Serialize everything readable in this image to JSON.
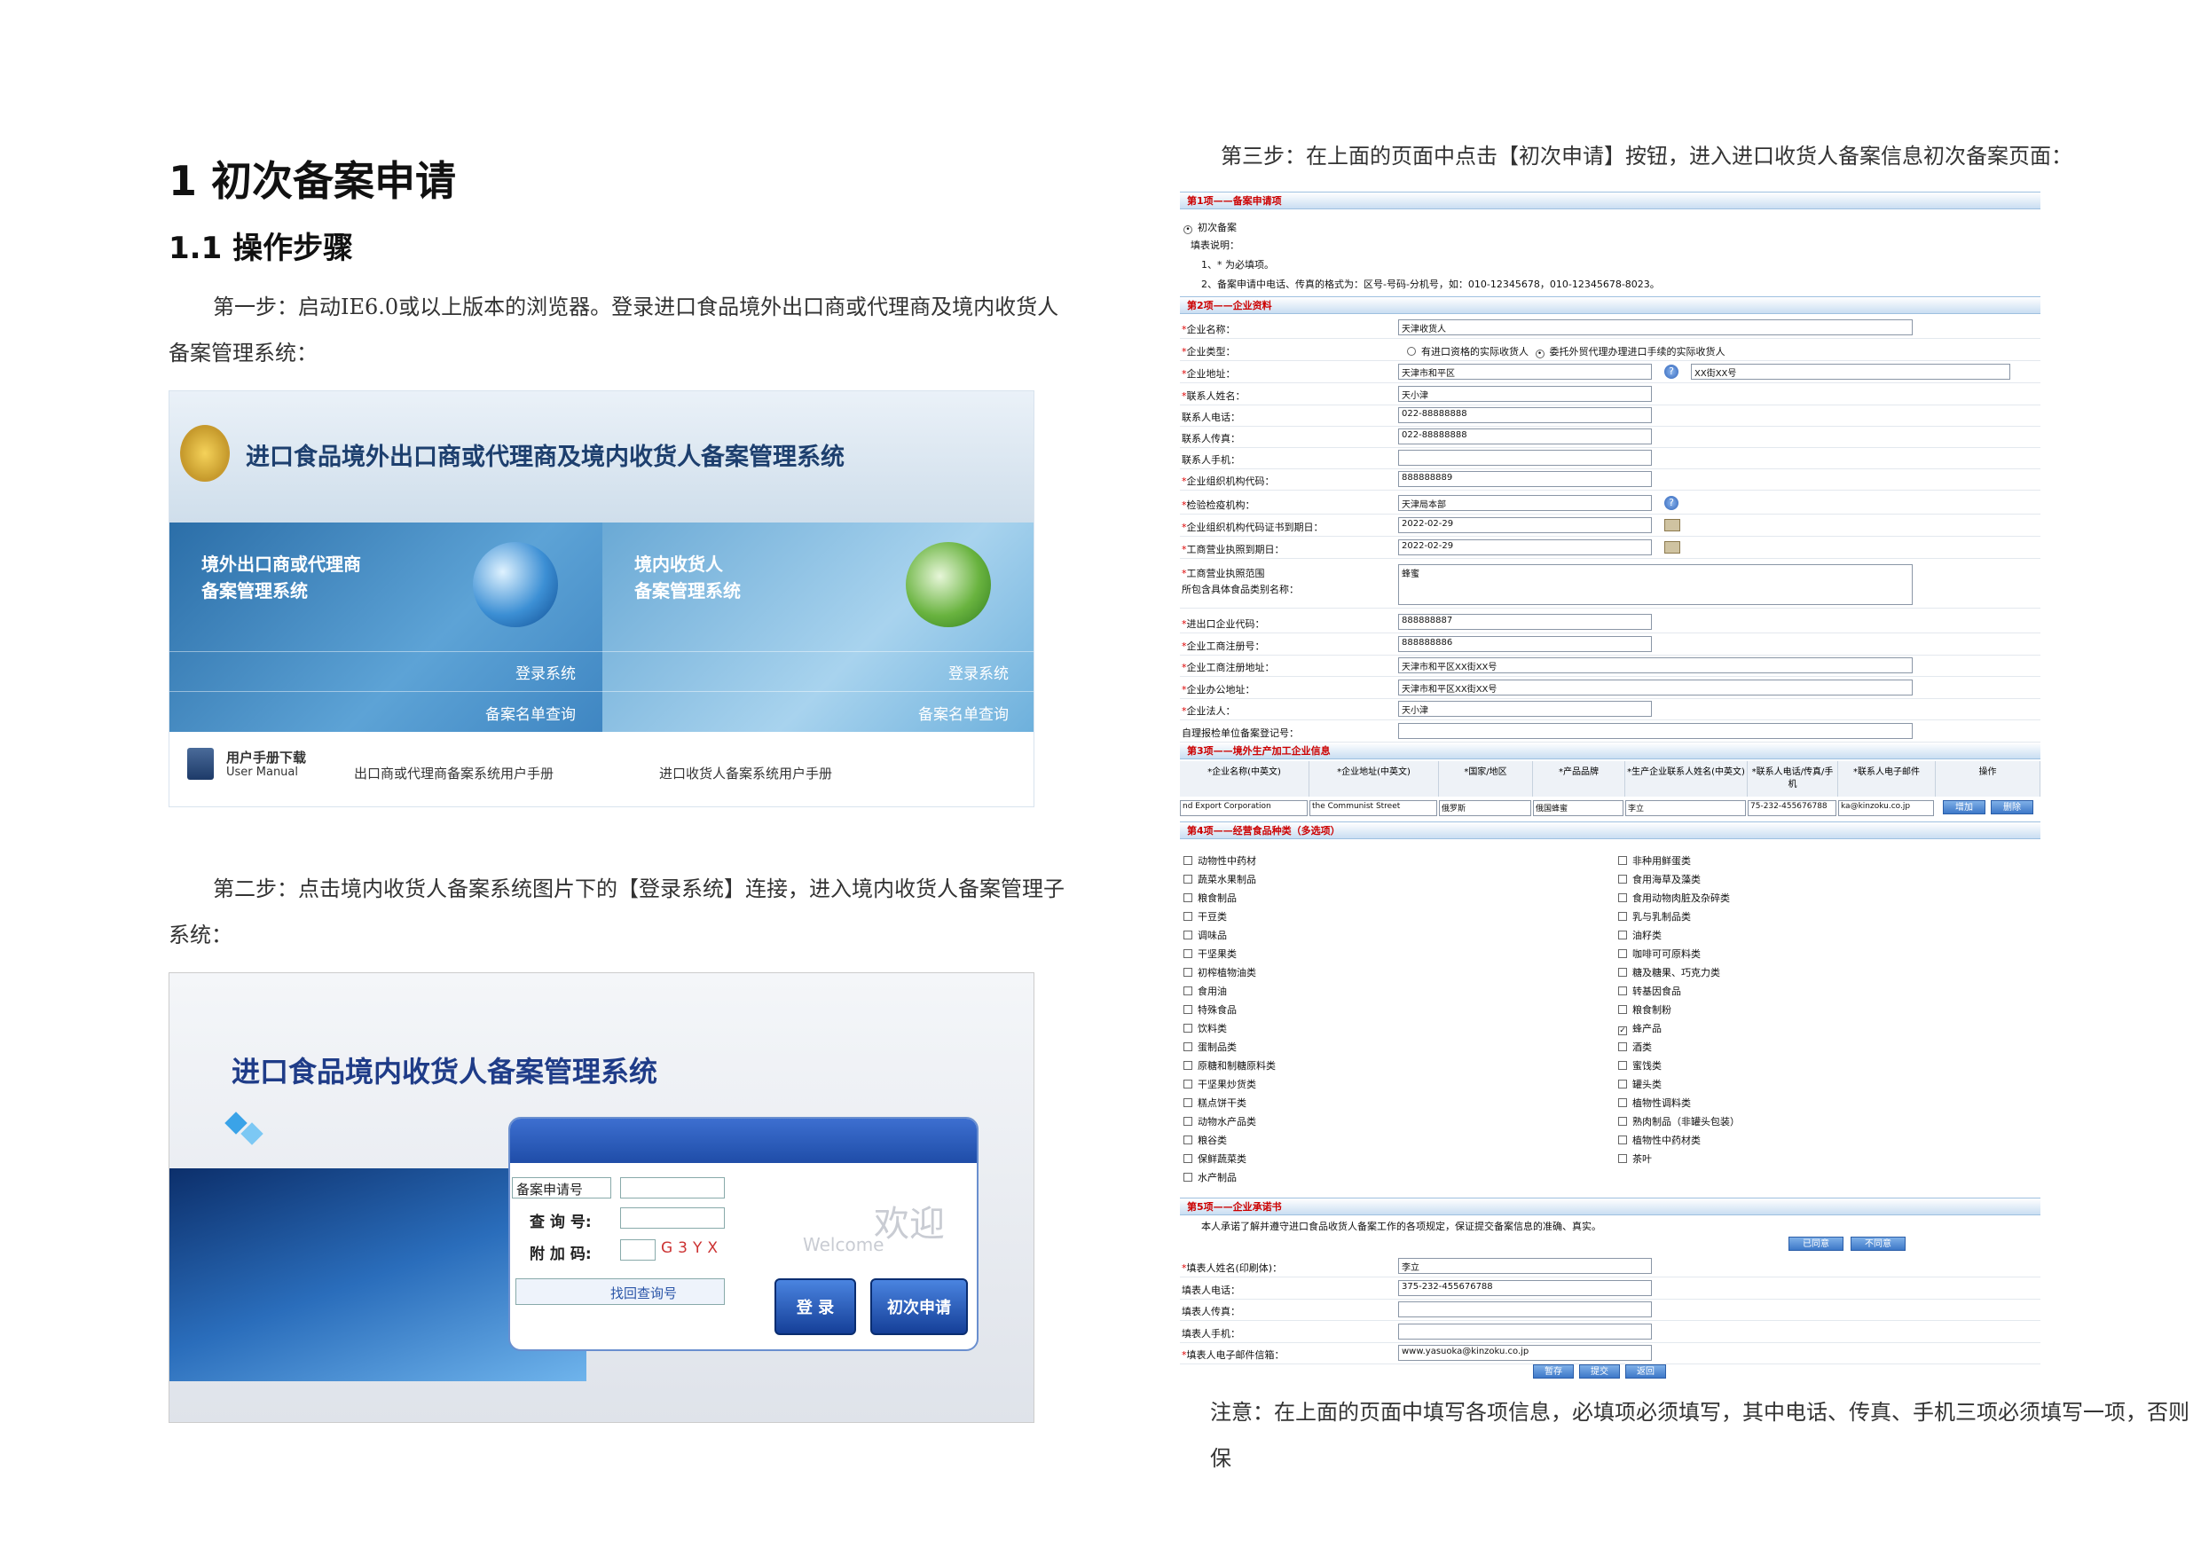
{
  "doc": {
    "h1": "1 初次备案申请",
    "h2": "1.1 操作步骤",
    "step1_line1": "第一步：启动IE6.0或以上版本的浏览器。登录进口食品境外出口商或代理商及境内收货人",
    "step1_line2": "备案管理系统：",
    "step2_line1": "第二步：点击境内收货人备案系统图片下的【登录系统】连接，进入境内收货人备案管理子",
    "step2_line2": "系统：",
    "step3": "第三步：在上面的页面中点击【初次申请】按钮，进入进口收货人备案信息初次备案页面：",
    "note": "注意：在上面的页面中填写各项信息，必填项必须填写，其中电话、传真、手机三项必须填写一项，否则保"
  },
  "shot1": {
    "system_title": "进口食品境外出口商或代理商及境内收货人备案管理系统",
    "left_panel_title": "境外出口商或代理商\n备案管理系统",
    "right_panel_title": "境内收货人\n备案管理系统",
    "login_link": "登录系统",
    "query_link": "备案名单查询",
    "manual_cn": "用户手册下载",
    "manual_en": "User Manual",
    "manual_link1": "出口商或代理商备案系统用户手册",
    "manual_link2": "进口收货人备案系统用户手册"
  },
  "shot2": {
    "title": "进口食品境内收货人备案管理系统",
    "select_value": "备案申请号",
    "query_label": "查 询 号:",
    "captcha_label": "附 加 码:",
    "captcha": "G3YX",
    "find_link": "找回查询号",
    "welcome_cn": "欢迎",
    "welcome_en": "Welcome",
    "login_btn": "登 录",
    "apply_btn": "初次申请"
  },
  "form": {
    "sec1": "第1项——备案申请项",
    "first_filing": "初次备案",
    "notes_title": "填表说明：",
    "note1": "1、* 为必填项。",
    "note2": "2、备案申请中电话、传真的格式为：区号-号码-分机号，如：010-12345678，010-12345678-8023。",
    "sec2": "第2项——企业资料",
    "fields": [
      {
        "label": "企业名称：",
        "req": true,
        "value": "天津收货人",
        "w": "long"
      },
      {
        "label": "企业类型：",
        "req": true,
        "value": "",
        "w": "radio"
      },
      {
        "label": "企业地址：",
        "req": true,
        "value": "天津市和平区",
        "w": "addr"
      },
      {
        "label": "联系人姓名：",
        "req": true,
        "value": "天小津",
        "w": "short"
      },
      {
        "label": "联系人电话：",
        "req": false,
        "value": "022-88888888",
        "w": "short"
      },
      {
        "label": "联系人传真：",
        "req": false,
        "value": "022-88888888",
        "w": "short"
      },
      {
        "label": "联系人手机：",
        "req": false,
        "value": "",
        "w": "short"
      },
      {
        "label": "企业组织机构代码：",
        "req": true,
        "value": "888888889",
        "w": "short"
      },
      {
        "label": "检验检疫机构：",
        "req": true,
        "value": "天津局本部",
        "w": "shortq"
      },
      {
        "label": "企业组织机构代码证书到期日：",
        "req": true,
        "value": "2022-02-29",
        "w": "date"
      },
      {
        "label": "工商营业执照到期日：",
        "req": true,
        "value": "2022-02-29",
        "w": "date"
      }
    ],
    "radio1": "有进口资格的实际收货人",
    "radio2": "委托外贸代理办理进口手续的实际收货人",
    "addr2": "XX街XX号",
    "scope_label1": "工商营业执照范围",
    "scope_label2": "所包含具体食品类别名称：",
    "scope_value": "蜂蜜",
    "fields2": [
      {
        "label": "进出口企业代码：",
        "req": true,
        "value": "888888887",
        "w": "short"
      },
      {
        "label": "企业工商注册号：",
        "req": true,
        "value": "888888886",
        "w": "short"
      },
      {
        "label": "企业工商注册地址：",
        "req": true,
        "value": "天津市和平区XX街XX号",
        "w": "long"
      },
      {
        "label": "企业办公地址：",
        "req": true,
        "value": "天津市和平区XX街XX号",
        "w": "long"
      },
      {
        "label": "企业法人：",
        "req": true,
        "value": "天小津",
        "w": "short"
      },
      {
        "label": "自理报检单位备案登记号：",
        "req": false,
        "value": "",
        "w": "long"
      }
    ],
    "sec3": "第3项——境外生产加工企业信息",
    "table_headers": [
      "*企业名称(中英文)",
      "*企业地址(中英文)",
      "*国家/地区",
      "*产品品牌",
      "*生产企业联系人姓名(中英文)",
      "*联系人电话/传真/手机",
      "*联系人电子邮件",
      "操作"
    ],
    "table_row": [
      "nd Export Corporation",
      "the Communist Street",
      "俄罗斯",
      "俄国蜂蜜",
      "李立",
      "75-232-455676788",
      "ka@kinzoku.co.jp"
    ],
    "add_btn": "增加",
    "del_btn": "删除",
    "sec4": "第4项——经营食品种类（多选项）",
    "cats_left": [
      "动物性中药材",
      "蔬菜水果制品",
      "粮食制品",
      "干豆类",
      "调味品",
      "干坚果类",
      "初榨植物油类",
      "食用油",
      "特殊食品",
      "饮料类",
      "蛋制品类",
      "原糖和制糖原料类",
      "干坚果炒货类",
      "糕点饼干类",
      "动物水产品类",
      "粮谷类",
      "保鲜蔬菜类",
      "水产制品"
    ],
    "cats_right": [
      "非种用鲜蛋类",
      "食用海草及藻类",
      "食用动物肉脏及杂碎类",
      "乳与乳制品类",
      "油籽类",
      "咖啡可可原料类",
      "糖及糖果、巧克力类",
      "转基因食品",
      "粮食制粉",
      "蜂产品",
      "酒类",
      "蜜饯类",
      "罐头类",
      "植物性调料类",
      "熟肉制品（非罐头包装）",
      "植物性中药材类",
      "茶叶"
    ],
    "checked_right_index": 9,
    "sec5": "第5项——企业承诺书",
    "pledge": "本人承诺了解并遵守进口食品收货人备案工作的各项规定，保证提交备案信息的准确、真实。",
    "agree_btn": "已同意",
    "disagree_btn": "不同意",
    "fields3": [
      {
        "label": "填表人姓名(印刷体)：",
        "req": true,
        "value": "李立"
      },
      {
        "label": "填表人电话：",
        "req": false,
        "value": "375-232-455676788"
      },
      {
        "label": "填表人传真：",
        "req": false,
        "value": ""
      },
      {
        "label": "填表人手机：",
        "req": false,
        "value": ""
      },
      {
        "label": "填表人电子邮件信箱：",
        "req": true,
        "value": "www.yasuoka@kinzoku.co.jp"
      }
    ],
    "save_btn": "暂存",
    "submit_btn": "提交",
    "back_btn": "返回"
  }
}
